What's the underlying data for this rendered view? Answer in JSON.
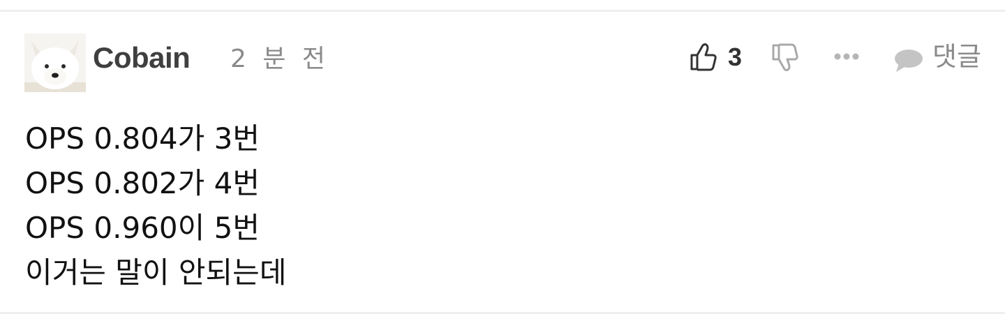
{
  "comment": {
    "author": "Cobain",
    "time": "2 분 전",
    "likes": "3",
    "reply_label": "댓글",
    "lines": [
      "OPS 0.804가 3번",
      "OPS 0.802가 4번",
      "OPS 0.960이 5번",
      "이거는 말이 안되는데"
    ]
  },
  "icons": {
    "avatar": "arctic-fox-avatar",
    "like": "thumbs-up-icon",
    "dislike": "thumbs-down-icon",
    "more": "more-dots-icon",
    "reply": "speech-bubble-icon"
  },
  "colors": {
    "author": "#3f3f3f",
    "meta": "#8a8a8a",
    "body": "#111111",
    "divider": "#efefef"
  }
}
